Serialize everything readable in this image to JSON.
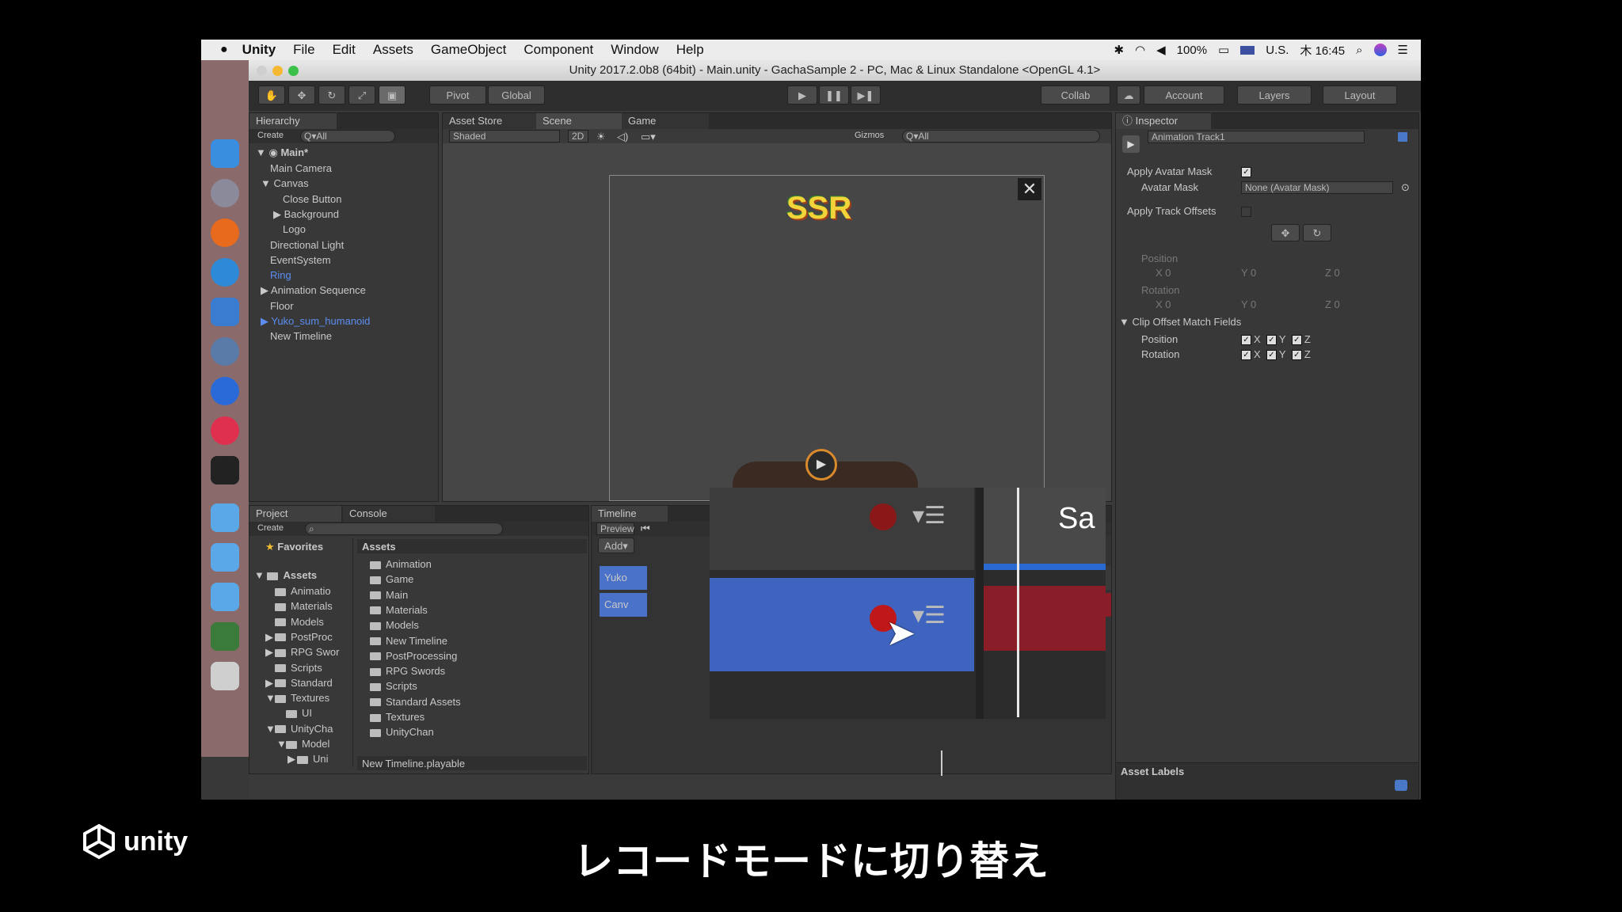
{
  "menubar": {
    "app": "Unity",
    "items": [
      "File",
      "Edit",
      "Assets",
      "GameObject",
      "Component",
      "Window",
      "Help"
    ],
    "battery": "100%",
    "locale": "U.S.",
    "clock": "木 16:45"
  },
  "window": {
    "title": "Unity 2017.2.0b8 (64bit) - Main.unity - GachaSample 2 - PC, Mac & Linux Standalone <OpenGL 4.1>"
  },
  "toolbar": {
    "pivot": "Pivot",
    "global": "Global",
    "collab": "Collab",
    "account": "Account",
    "layers": "Layers",
    "layout": "Layout"
  },
  "hierarchy": {
    "tab": "Hierarchy",
    "create": "Create",
    "search_placeholder": "Q▾All",
    "scene": "Main*",
    "items": [
      {
        "label": "Main Camera",
        "indent": 1,
        "arrow": "",
        "blue": false
      },
      {
        "label": "Canvas",
        "indent": 1,
        "arrow": "▼",
        "blue": false
      },
      {
        "label": "Close Button",
        "indent": 2,
        "arrow": "",
        "blue": false
      },
      {
        "label": "Background",
        "indent": 2,
        "arrow": "▶",
        "blue": false
      },
      {
        "label": "Logo",
        "indent": 2,
        "arrow": "",
        "blue": false
      },
      {
        "label": "Directional Light",
        "indent": 1,
        "arrow": "",
        "blue": false
      },
      {
        "label": "EventSystem",
        "indent": 1,
        "arrow": "",
        "blue": false
      },
      {
        "label": "Ring",
        "indent": 1,
        "arrow": "",
        "blue": true
      },
      {
        "label": "Animation Sequence",
        "indent": 1,
        "arrow": "▶",
        "blue": false
      },
      {
        "label": "Floor",
        "indent": 1,
        "arrow": "",
        "blue": false
      },
      {
        "label": "Yuko_sum_humanoid",
        "indent": 1,
        "arrow": "▶",
        "blue": true
      },
      {
        "label": "New Timeline",
        "indent": 1,
        "arrow": "",
        "blue": false
      }
    ]
  },
  "scene": {
    "tabs": [
      "Asset Store",
      "Scene",
      "Game"
    ],
    "shaded": "Shaded",
    "mode2d": "2D",
    "gizmos": "Gizmos",
    "search_placeholder": "Q▾All",
    "ssr": "SSR"
  },
  "inspector": {
    "tab": "Inspector",
    "object": "Animation Track1",
    "apply_avatar_mask": "Apply Avatar Mask",
    "avatar_mask": "Avatar Mask",
    "avatar_mask_value": "None (Avatar Mask)",
    "apply_track_offsets": "Apply Track Offsets",
    "position": "Position",
    "rotation": "Rotation",
    "x0": "X  0",
    "y0": "Y  0",
    "z0": "Z  0",
    "clip_offset": "Clip Offset Match Fields",
    "axis_x": "X",
    "axis_y": "Y",
    "axis_z": "Z",
    "asset_labels": "Asset Labels"
  },
  "project": {
    "tabs": [
      "Project",
      "Console"
    ],
    "create": "Create",
    "favorites": "Favorites",
    "assets": "Assets",
    "tree": [
      {
        "label": "Animatio",
        "indent": 1,
        "arrow": ""
      },
      {
        "label": "Materials",
        "indent": 1,
        "arrow": ""
      },
      {
        "label": "Models",
        "indent": 1,
        "arrow": ""
      },
      {
        "label": "PostProc",
        "indent": 1,
        "arrow": "▶"
      },
      {
        "label": "RPG Swor",
        "indent": 1,
        "arrow": "▶"
      },
      {
        "label": "Scripts",
        "indent": 1,
        "arrow": ""
      },
      {
        "label": "Standard",
        "indent": 1,
        "arrow": "▶"
      },
      {
        "label": "Textures",
        "indent": 1,
        "arrow": "▼"
      },
      {
        "label": "UI",
        "indent": 2,
        "arrow": ""
      },
      {
        "label": "UnityCha",
        "indent": 1,
        "arrow": "▼"
      },
      {
        "label": "Model",
        "indent": 2,
        "arrow": "▼"
      },
      {
        "label": "Uni",
        "indent": 3,
        "arrow": "▶"
      }
    ],
    "assets_header": "Assets",
    "files": [
      "Animation",
      "Game",
      "Main",
      "Materials",
      "Models",
      "New Timeline",
      "PostProcessing",
      "RPG Swords",
      "Scripts",
      "Standard Assets",
      "Textures",
      "UnityChan"
    ],
    "footer": "New Timeline.playable"
  },
  "timeline": {
    "tab": "Timeline",
    "preview": "Preview",
    "add": "Add▾",
    "track1": "Yuko",
    "track2": "Canv",
    "clip_text": "Sa"
  },
  "caption": "レコードモードに切り替え",
  "logo": "unity"
}
